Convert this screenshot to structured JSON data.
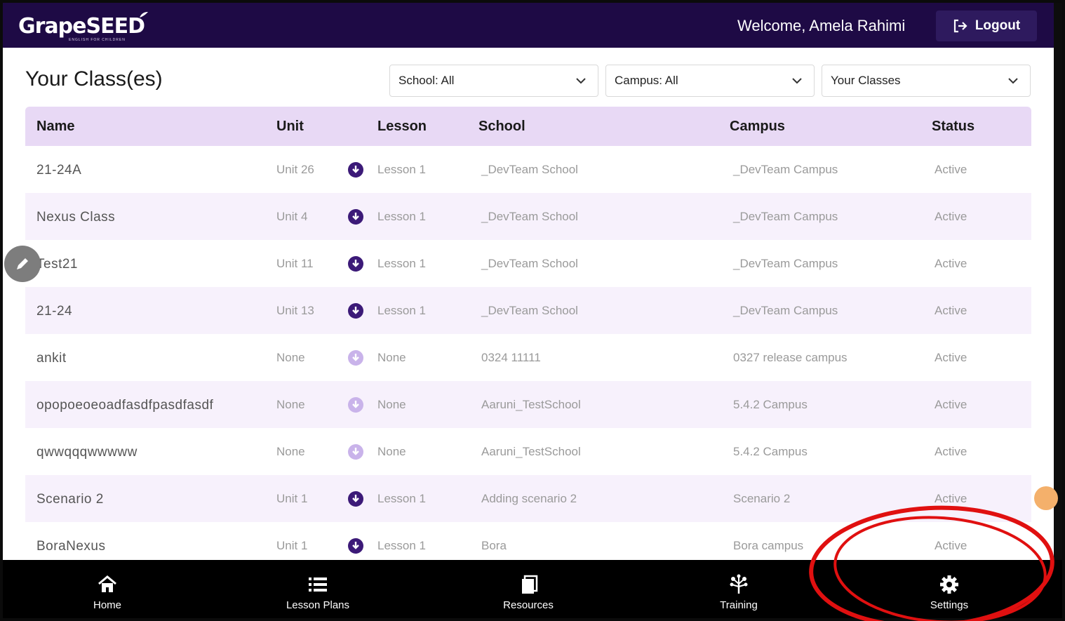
{
  "header": {
    "logo_text": "GrapeSEED",
    "logo_subtitle": "ENGLISH FOR CHILDREN",
    "welcome": "Welcome, Amela Rahimi",
    "logout_label": "Logout"
  },
  "page": {
    "title": "Your Class(es)"
  },
  "filters": {
    "school": "School: All",
    "campus": "Campus: All",
    "classes": "Your Classes"
  },
  "table": {
    "columns": [
      "Name",
      "Unit",
      "Lesson",
      "School",
      "Campus",
      "Status"
    ],
    "rows": [
      {
        "name": "21-24A",
        "unit": "Unit 26",
        "lesson": "Lesson 1",
        "school": "_DevTeam School",
        "campus": "_DevTeam Campus",
        "status": "Active",
        "download_active": true
      },
      {
        "name": "Nexus Class",
        "unit": "Unit 4",
        "lesson": "Lesson 1",
        "school": "_DevTeam School",
        "campus": "_DevTeam Campus",
        "status": "Active",
        "download_active": true
      },
      {
        "name": "Test21",
        "unit": "Unit 11",
        "lesson": "Lesson 1",
        "school": "_DevTeam School",
        "campus": "_DevTeam Campus",
        "status": "Active",
        "download_active": true
      },
      {
        "name": "21-24",
        "unit": "Unit 13",
        "lesson": "Lesson 1",
        "school": "_DevTeam School",
        "campus": "_DevTeam Campus",
        "status": "Active",
        "download_active": true
      },
      {
        "name": "ankit",
        "unit": "None",
        "lesson": "None",
        "school": "0324 11111",
        "campus": "0327 release campus",
        "status": "Active",
        "download_active": false
      },
      {
        "name": "opopoeoeoadfasdfpasdfasdf",
        "unit": "None",
        "lesson": "None",
        "school": "Aaruni_TestSchool",
        "campus": "5.4.2 Campus",
        "status": "Active",
        "download_active": false
      },
      {
        "name": "qwwqqqwwwww",
        "unit": "None",
        "lesson": "None",
        "school": "Aaruni_TestSchool",
        "campus": "5.4.2 Campus",
        "status": "Active",
        "download_active": false
      },
      {
        "name": "Scenario 2",
        "unit": "Unit 1",
        "lesson": "Lesson 1",
        "school": "Adding scenario 2",
        "campus": "Scenario 2",
        "status": "Active",
        "download_active": true
      },
      {
        "name": "BoraNexus",
        "unit": "Unit 1",
        "lesson": "Lesson 1",
        "school": "Bora",
        "campus": "Bora campus",
        "status": "Active",
        "download_active": true
      }
    ]
  },
  "bottom_nav": {
    "items": [
      {
        "label": "Home",
        "icon": "home-icon"
      },
      {
        "label": "Lesson Plans",
        "icon": "list-icon"
      },
      {
        "label": "Resources",
        "icon": "book-icon"
      },
      {
        "label": "Training",
        "icon": "tree-icon"
      },
      {
        "label": "Settings",
        "icon": "gear-icon"
      }
    ]
  },
  "colors": {
    "header_bg": "#1e0a45",
    "accent_purple": "#3c1a78",
    "table_header_bg": "#e8d9f5",
    "row_alt_bg": "#f7f1fc",
    "annotation_red": "#e01010"
  }
}
